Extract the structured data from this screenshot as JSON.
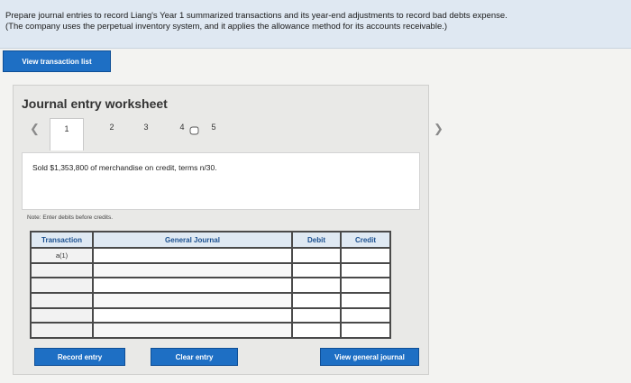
{
  "instructions": {
    "line1": "Prepare journal entries to record Liang's Year 1 summarized transactions and its year-end adjustments to record bad debts expense.",
    "line2": "(The company uses the perpetual inventory system, and it applies the allowance method for its accounts receivable.)"
  },
  "buttons": {
    "view_transaction_list": "View transaction list",
    "record_entry": "Record entry",
    "clear_entry": "Clear entry",
    "view_general_journal": "View general journal"
  },
  "worksheet": {
    "title": "Journal entry worksheet",
    "tabs": [
      "1",
      "2",
      "3",
      "4",
      "5"
    ],
    "active_tab": "1",
    "prev_icon": "chevron-left-icon",
    "next_icon": "chevron-right-icon",
    "description": "Sold $1,353,800 of merchandise on credit, terms n/30.",
    "note": "Note: Enter debits before credits."
  },
  "journal": {
    "headers": [
      "Transaction",
      "General Journal",
      "Debit",
      "Credit"
    ],
    "rows": [
      {
        "transaction": "a(1)"
      },
      {
        "transaction": ""
      },
      {
        "transaction": ""
      },
      {
        "transaction": ""
      },
      {
        "transaction": ""
      },
      {
        "transaction": ""
      }
    ]
  },
  "colors": {
    "button_blue": "#1e6fc4",
    "header_text": "#1a4f8f",
    "instruction_bg": "#dfe8f2"
  }
}
